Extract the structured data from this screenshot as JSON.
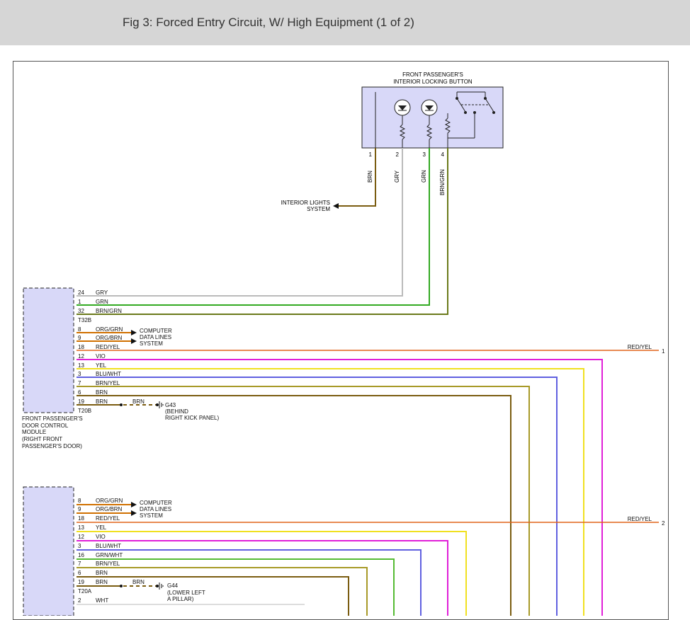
{
  "header": {
    "title": "Fig 3: Forced Entry Circuit, W/ High Equipment (1 of 2)"
  },
  "switch": {
    "title_line1": "FRONT PASSENGER'S",
    "title_line2": "INTERIOR LOCKING BUTTON",
    "pins": [
      "1",
      "2",
      "3",
      "4"
    ],
    "wires": [
      "BRN",
      "GRY",
      "GRN",
      "BRN/GRN"
    ]
  },
  "interior_lights": {
    "line1": "INTERIOR LIGHTS",
    "line2": "SYSTEM"
  },
  "module1": {
    "connector_top": "T32B",
    "connector_bottom": "T20B",
    "label_lines": [
      "FRONT PASSENGER'S",
      "DOOR CONTROL",
      "MODULE",
      "(RIGHT FRONT",
      "PASSENGER'S DOOR)"
    ],
    "pins": [
      {
        "pin": "24",
        "wire": "GRY"
      },
      {
        "pin": "1",
        "wire": "GRN"
      },
      {
        "pin": "32",
        "wire": "BRN/GRN"
      },
      {
        "pin": "8",
        "wire": "ORG/GRN"
      },
      {
        "pin": "9",
        "wire": "ORG/BRN"
      },
      {
        "pin": "18",
        "wire": "RED/YEL"
      },
      {
        "pin": "12",
        "wire": "VIO"
      },
      {
        "pin": "13",
        "wire": "YEL"
      },
      {
        "pin": "3",
        "wire": "BLU/WHT"
      },
      {
        "pin": "7",
        "wire": "BRN/YEL"
      },
      {
        "pin": "6",
        "wire": "BRN"
      },
      {
        "pin": "19",
        "wire": "BRN"
      }
    ],
    "data_lines": [
      "COMPUTER",
      "DATA LINES",
      "SYSTEM"
    ],
    "ground_wire": "BRN",
    "ground": "G43",
    "ground_desc": [
      "(BEHIND",
      "RIGHT KICK PANEL)"
    ],
    "offpage_wire": "RED/YEL",
    "offpage_ref": "1"
  },
  "module2": {
    "connector_bottom": "T20A",
    "pins": [
      {
        "pin": "8",
        "wire": "ORG/GRN"
      },
      {
        "pin": "9",
        "wire": "ORG/BRN"
      },
      {
        "pin": "18",
        "wire": "RED/YEL"
      },
      {
        "pin": "13",
        "wire": "YEL"
      },
      {
        "pin": "12",
        "wire": "VIO"
      },
      {
        "pin": "3",
        "wire": "BLU/WHT"
      },
      {
        "pin": "16",
        "wire": "GRN/WHT"
      },
      {
        "pin": "7",
        "wire": "BRN/YEL"
      },
      {
        "pin": "6",
        "wire": "BRN"
      },
      {
        "pin": "19",
        "wire": "BRN"
      },
      {
        "pin": "2",
        "wire": "WHT"
      }
    ],
    "data_lines": [
      "COMPUTER",
      "DATA LINES",
      "SYSTEM"
    ],
    "ground_wire": "BRN",
    "ground": "G44",
    "ground_desc": [
      "(LOWER LEFT",
      "A PILLAR)"
    ],
    "offpage_wire": "RED/YEL",
    "offpage_ref": "2"
  },
  "colors": {
    "brn": "#7a5c10",
    "gry": "#bbbbbb",
    "grn": "#33aa22",
    "brn_grn": "#6b7a1a",
    "red_yel": "#e0641a",
    "vio": "#e020d8",
    "yel": "#f0e020",
    "blu_wht": "#6060e0",
    "brn_yel": "#a89a28",
    "org": "#d07000",
    "grn_wht": "#55bb33",
    "component_fill": "#d8d8f8"
  }
}
